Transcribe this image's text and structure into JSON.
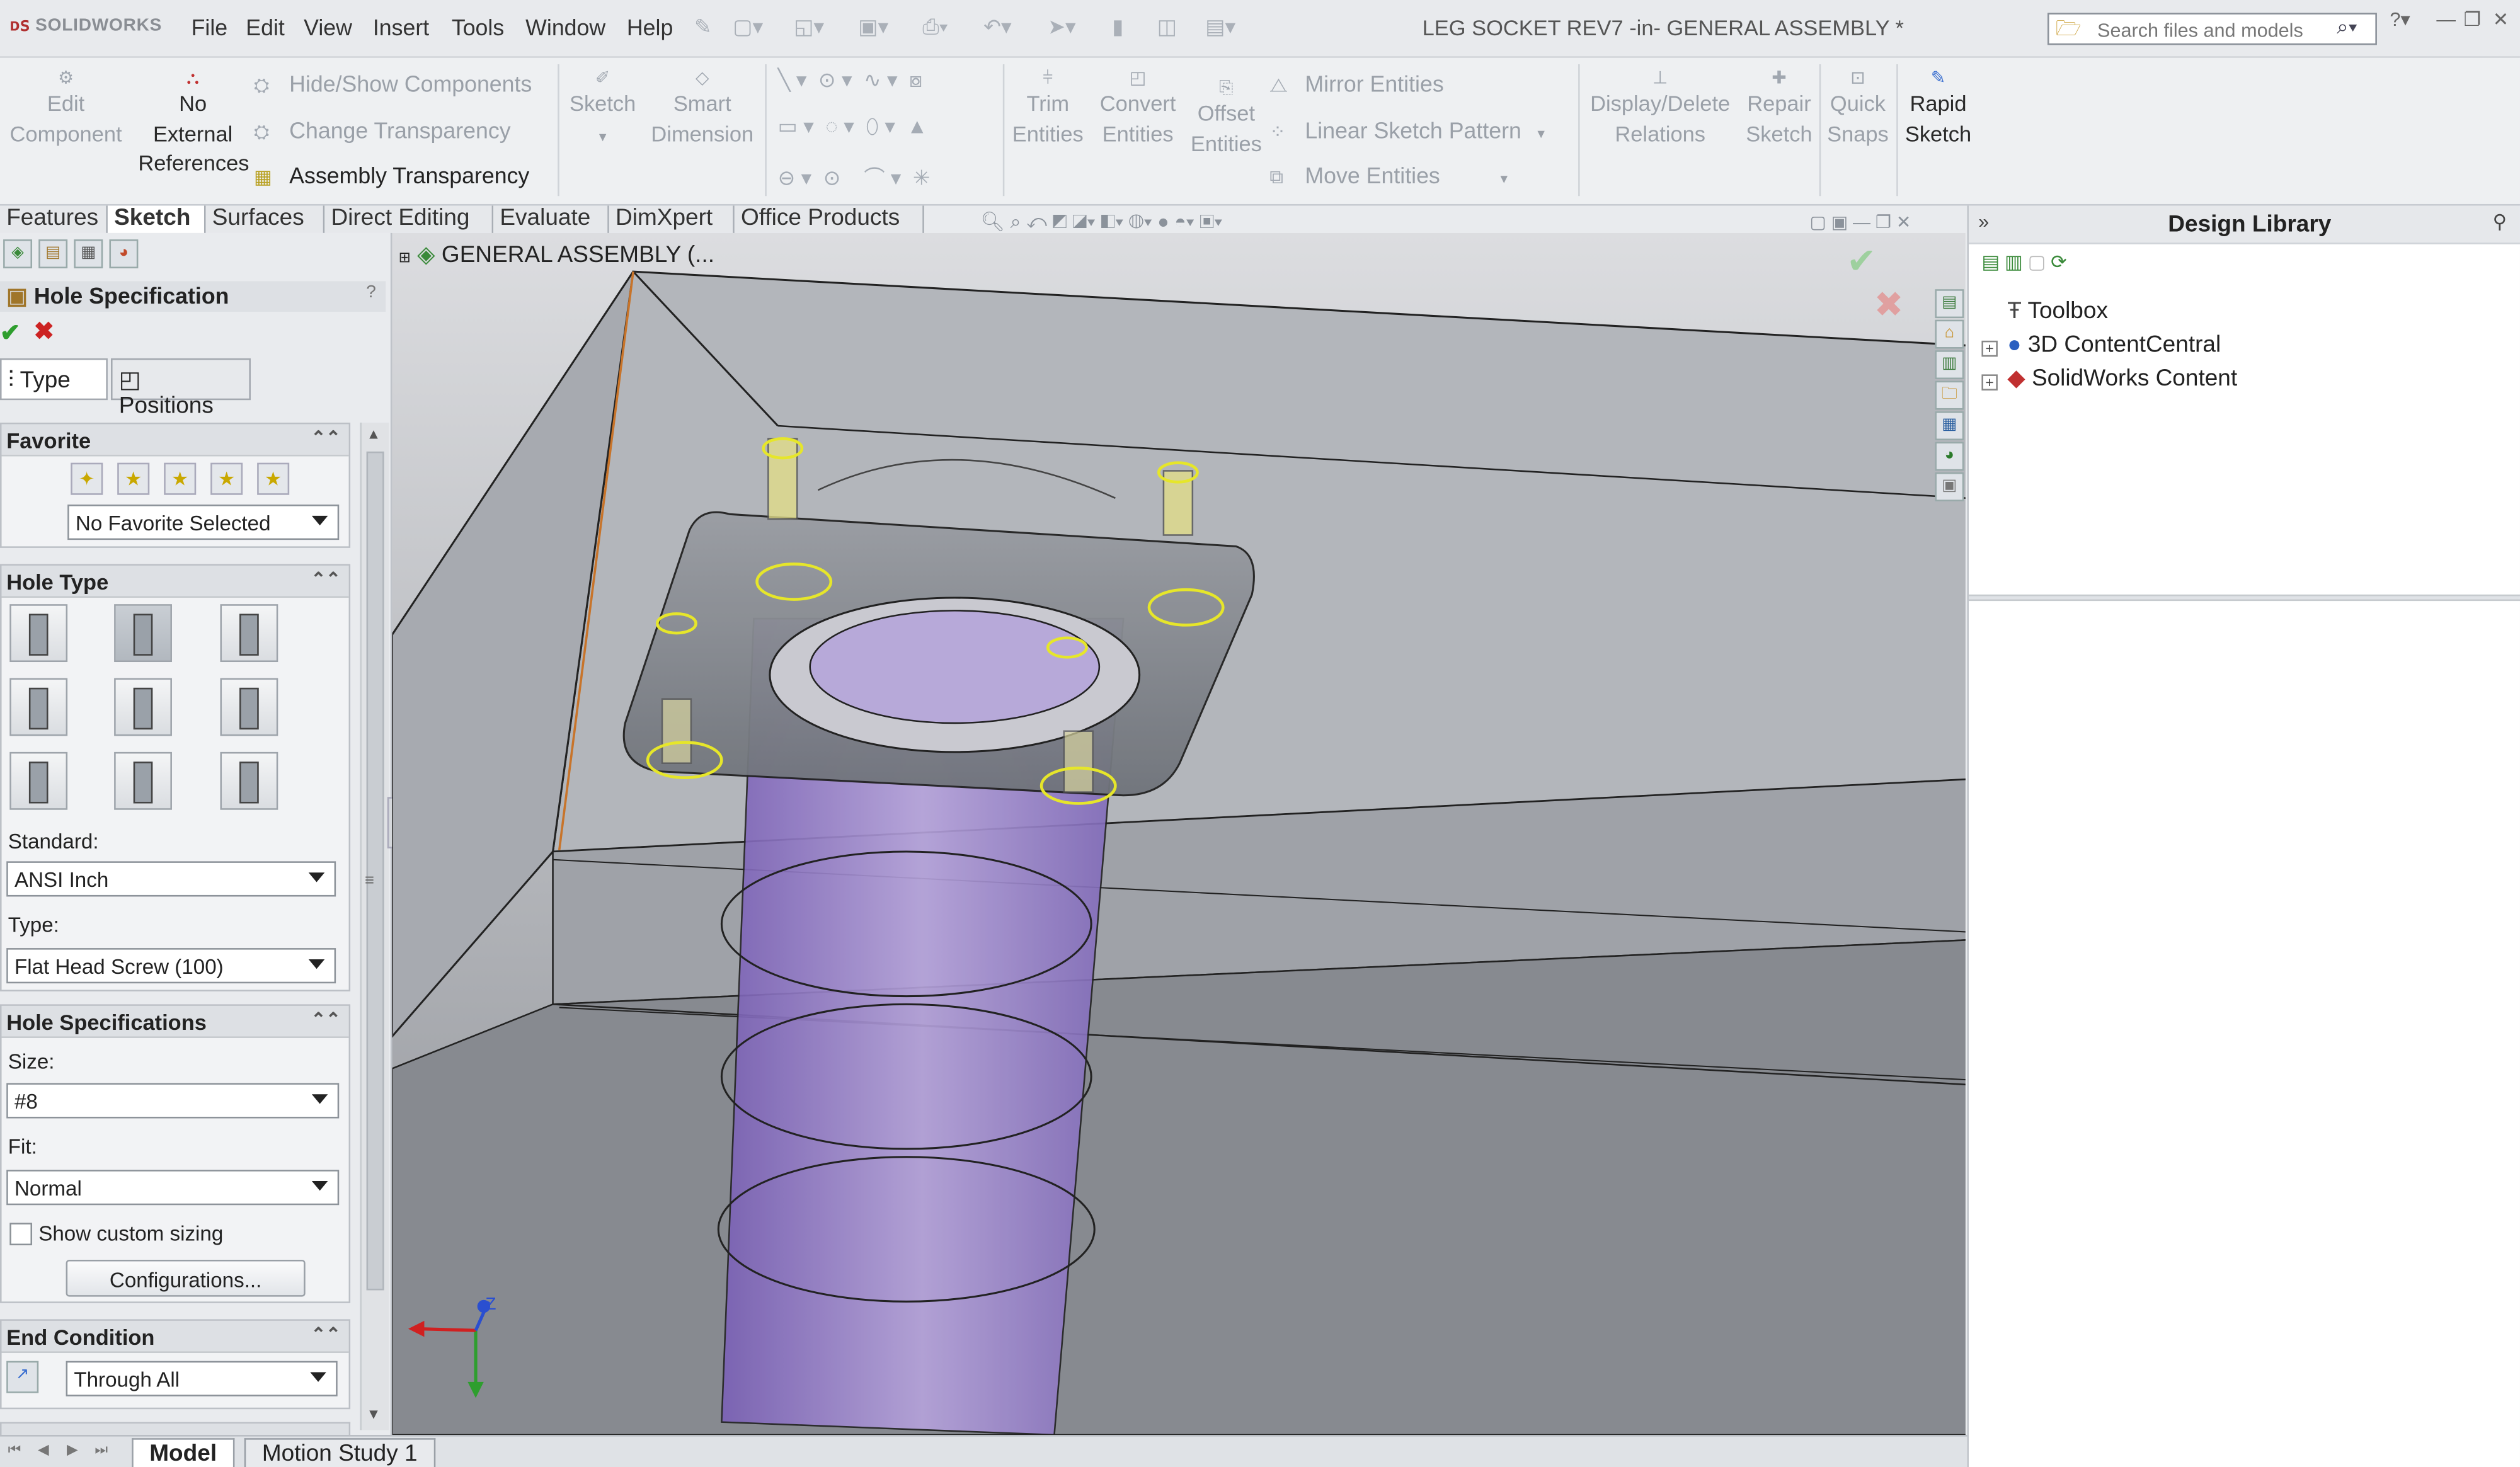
{
  "app": {
    "logo": "SOLIDWORKS",
    "window_title": "LEG SOCKET REV7 -in- GENERAL ASSEMBLY *"
  },
  "menu": [
    "File",
    "Edit",
    "View",
    "Insert",
    "Tools",
    "Window",
    "Help"
  ],
  "search": {
    "placeholder": "Search files and models"
  },
  "commands": {
    "edit_component": [
      "Edit",
      "Component"
    ],
    "no_external": [
      "No",
      "External",
      "References"
    ],
    "hide_show": "Hide/Show Components",
    "change_transparency": "Change Transparency",
    "assembly_transparency": "Assembly Transparency",
    "sketch": "Sketch",
    "smart_dimension": [
      "Smart",
      "Dimension"
    ],
    "trim": [
      "Trim",
      "Entities"
    ],
    "convert": [
      "Convert",
      "Entities"
    ],
    "offset": [
      "Offset",
      "Entities"
    ],
    "mirror": "Mirror Entities",
    "linear_pattern": "Linear Sketch Pattern",
    "move": "Move Entities",
    "display_delete": [
      "Display/Delete",
      "Relations"
    ],
    "repair": [
      "Repair",
      "Sketch"
    ],
    "quick_snaps": [
      "Quick",
      "Snaps"
    ],
    "rapid_sketch": [
      "Rapid",
      "Sketch"
    ]
  },
  "tabs": [
    "Features",
    "Sketch",
    "Surfaces",
    "Direct Editing",
    "Evaluate",
    "DimXpert",
    "Office Products"
  ],
  "active_tab": "Sketch",
  "property_manager": {
    "title": "Hole Specification",
    "help": "?",
    "ok": "✔",
    "cancel": "✖",
    "tab_type": "Type",
    "tab_positions": "Positions",
    "favorite": {
      "header": "Favorite",
      "selected": "No Favorite Selected"
    },
    "hole_type": {
      "header": "Hole Type",
      "standard_label": "Standard:",
      "standard_value": "ANSI Inch",
      "type_label": "Type:",
      "type_value": "Flat Head Screw (100)"
    },
    "hole_specs": {
      "header": "Hole Specifications",
      "size_label": "Size:",
      "size_value": "#8",
      "fit_label": "Fit:",
      "fit_value": "Normal",
      "custom_sizing": "Show custom sizing",
      "configurations": "Configurations..."
    },
    "end_condition": {
      "header": "End Condition",
      "value": "Through All"
    }
  },
  "tree": {
    "root": "GENERAL ASSEMBLY (..."
  },
  "design_library": {
    "title": "Design Library",
    "items": [
      "Toolbox",
      "3D ContentCentral",
      "SolidWorks Content"
    ]
  },
  "bottom_tabs": [
    "Model",
    "Motion Study 1"
  ],
  "colors": {
    "hole_highlight": "#e6e62a",
    "tube": "#8a6fc4",
    "accept": "#2e9e2e",
    "reject": "#cc2222"
  }
}
